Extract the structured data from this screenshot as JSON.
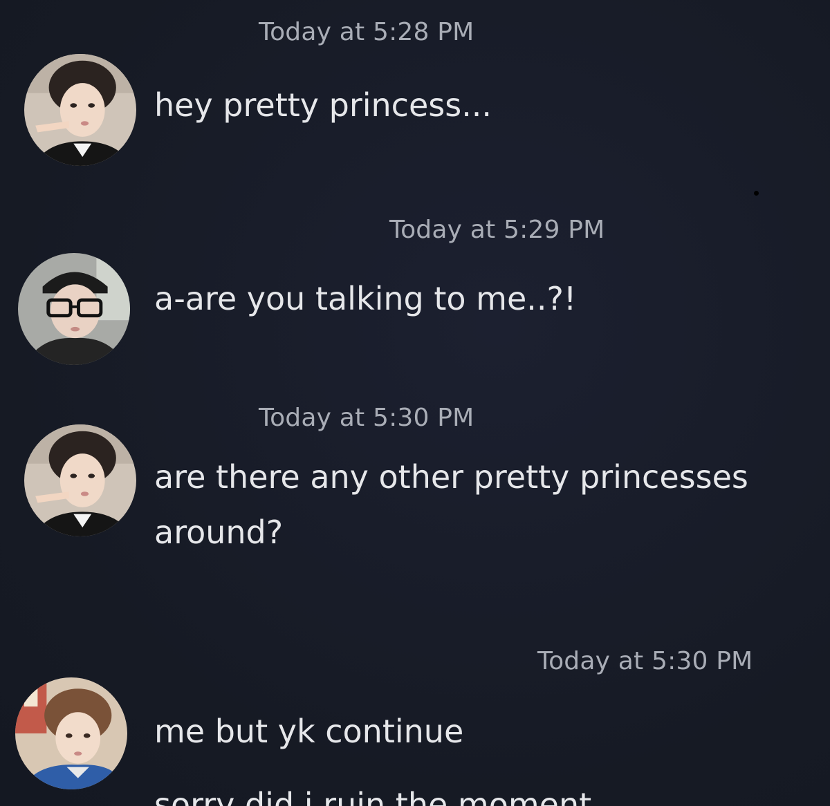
{
  "messages": [
    {
      "timestamp": "Today at 5:28 PM",
      "avatar": "profile-photo-1",
      "lines": [
        "hey pretty princess..."
      ]
    },
    {
      "timestamp": "Today at 5:29 PM",
      "avatar": "profile-photo-2",
      "lines": [
        "a-are you talking to me..?!"
      ]
    },
    {
      "timestamp": "Today at 5:30 PM",
      "avatar": "profile-photo-1",
      "lines": [
        "are there any other pretty princesses",
        "around?"
      ]
    },
    {
      "timestamp": "Today at 5:30 PM",
      "avatar": "profile-photo-3",
      "lines": [
        "me but yk continue",
        "sorry did i ruin the moment"
      ]
    }
  ]
}
